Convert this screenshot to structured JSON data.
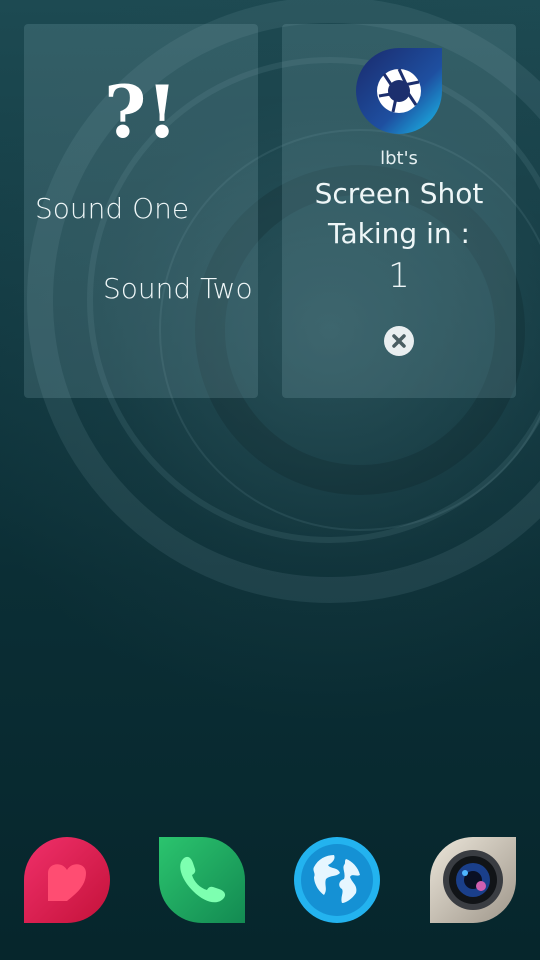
{
  "sound_tile": {
    "symbol": "?!",
    "item_one": "Sound One",
    "item_two": "Sound Two"
  },
  "screenshot_tile": {
    "app_icon": "aperture-icon",
    "owner": "lbt's",
    "title_line1": "Screen Shot",
    "title_line2": "Taking in :",
    "countdown": "1",
    "close_icon": "close-icon"
  },
  "dock": {
    "apps": [
      {
        "name": "people",
        "icon": "heart-icon",
        "color": "#e21e4c"
      },
      {
        "name": "phone",
        "icon": "phone-icon",
        "color": "#1fa860"
      },
      {
        "name": "browser",
        "icon": "globe-icon",
        "color": "#1aa3e8"
      },
      {
        "name": "camera",
        "icon": "camera-lens-icon",
        "color": "#cfc6b8"
      }
    ]
  },
  "colors": {
    "tile_bg": "rgba(130,175,180,0.22)",
    "text": "#eef6f7",
    "accent_shot": "#1b8fd6"
  }
}
